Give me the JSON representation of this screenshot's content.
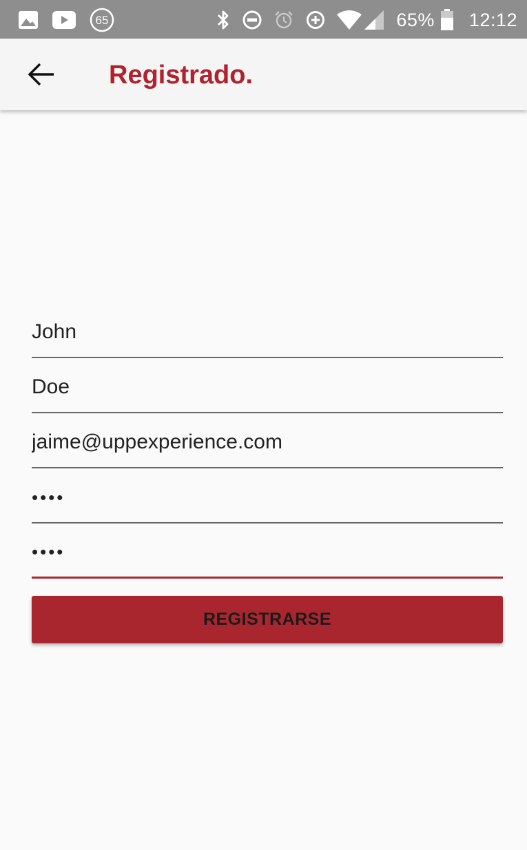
{
  "status_bar": {
    "notifications": [
      {
        "icon": "gallery-icon"
      },
      {
        "icon": "youtube-icon"
      },
      {
        "icon": "badge-65-icon",
        "label": "65"
      }
    ],
    "system_icons": [
      "bluetooth-icon",
      "do-not-disturb-icon",
      "alarm-icon",
      "data-saver-icon",
      "wifi-icon",
      "cell-signal-icon"
    ],
    "battery_percent": "65%",
    "battery_level": 0.65,
    "time": "12:12"
  },
  "app_bar": {
    "back_icon": "arrow-back-icon",
    "title": "Registrado."
  },
  "form": {
    "first_name": "John",
    "last_name": "Doe",
    "email": "jaime@uppexperience.com",
    "password": "1234",
    "password_confirm": "1234",
    "submit_label": "REGISTRARSE"
  },
  "colors": {
    "accent": "#b0222d",
    "button": "#a9262f",
    "status_bar": "#8e8e8e",
    "app_bar": "#f5f5f5",
    "background": "#fafafa"
  }
}
